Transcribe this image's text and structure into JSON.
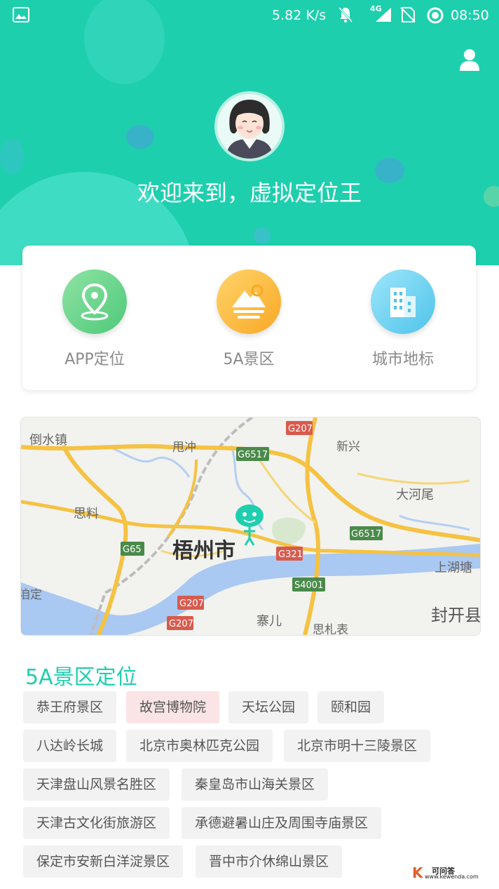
{
  "status_bar": {
    "speed": "5.82 K/s",
    "network": "4G",
    "time": "08:50"
  },
  "header": {
    "welcome": "欢迎来到，虚拟定位王",
    "bg_color": "#1ecfae"
  },
  "features": [
    {
      "label": "APP定位",
      "icon": "location-pin-icon",
      "color": "#6fd68c"
    },
    {
      "label": "5A景区",
      "icon": "mountain-icon",
      "color": "#fdbb2d"
    },
    {
      "label": "城市地标",
      "icon": "building-icon",
      "color": "#5fd0ef"
    }
  ],
  "map": {
    "labels": {
      "daoshui": "倒水镇",
      "shuaichong": "甩冲",
      "xinxing": "新兴",
      "daheyi": "大河尾",
      "siliao": "思料",
      "wuzhou": "梧州市",
      "shanghutang": "上湖塘",
      "zhaier": "寨儿",
      "fengkai": "封开县",
      "sizhabiao": "思札表",
      "jiding": "洎定"
    },
    "roads": {
      "g207a": "G207",
      "g6517a": "G6517",
      "g6517b": "G6517",
      "g65": "G65",
      "g321": "G321",
      "s4001": "S4001",
      "g207b": "G207",
      "g207c": "G207"
    }
  },
  "section": {
    "title": "5A景区定位"
  },
  "tags": [
    "恭王府景区",
    "故宫博物院",
    "天坛公园",
    "颐和园",
    "八达岭长城",
    "北京市奥林匹克公园",
    "北京市明十三陵景区",
    "天津盘山风景名胜区",
    "秦皇岛市山海关景区",
    "天津古文化街旅游区",
    "承德避暑山庄及周围寺庙景区",
    "保定市安新白洋淀景区",
    "晋中市介休绵山景区"
  ],
  "watermark": {
    "logo": "K",
    "text": "可问答",
    "url": "www.kewenda.com"
  }
}
